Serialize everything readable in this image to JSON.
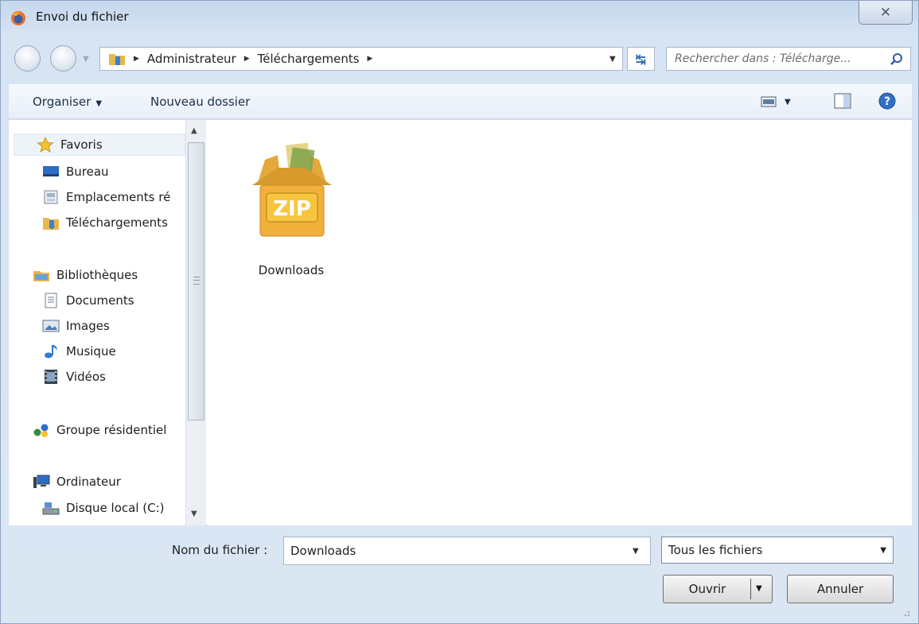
{
  "window": {
    "title": "Envoi du fichier",
    "close_symbol": "✕"
  },
  "navigation": {
    "breadcrumbs": [
      "Administrateur",
      "Téléchargements"
    ],
    "search_placeholder": "Rechercher dans : Télécharge..."
  },
  "toolbar": {
    "organise_label": "Organiser",
    "new_folder_label": "Nouveau dossier"
  },
  "sidebar": {
    "favorites": {
      "label": "Favoris",
      "icon": "star-icon"
    },
    "favorite_items": [
      {
        "label": "Bureau",
        "icon": "desktop-icon"
      },
      {
        "label": "Emplacements ré",
        "icon": "recent-places-icon"
      },
      {
        "label": "Téléchargements",
        "icon": "downloads-folder-icon"
      }
    ],
    "libraries": {
      "label": "Bibliothèques",
      "icon": "libraries-icon"
    },
    "library_items": [
      {
        "label": "Documents",
        "icon": "documents-icon"
      },
      {
        "label": "Images",
        "icon": "images-icon"
      },
      {
        "label": "Musique",
        "icon": "music-icon"
      },
      {
        "label": "Vidéos",
        "icon": "videos-icon"
      }
    ],
    "homegroup": {
      "label": "Groupe résidentiel",
      "icon": "homegroup-icon"
    },
    "computer": {
      "label": "Ordinateur",
      "icon": "computer-icon"
    },
    "computer_items": [
      {
        "label": "Disque local (C:)",
        "icon": "local-disk-icon"
      }
    ]
  },
  "files": [
    {
      "name": "Downloads",
      "icon": "zip-archive-icon",
      "icon_text": "ZIP"
    }
  ],
  "footer": {
    "filename_label": "Nom du fichier :",
    "filename_value": "Downloads",
    "filetype_value": "Tous les fichiers",
    "open_label": "Ouvrir",
    "cancel_label": "Annuler"
  }
}
